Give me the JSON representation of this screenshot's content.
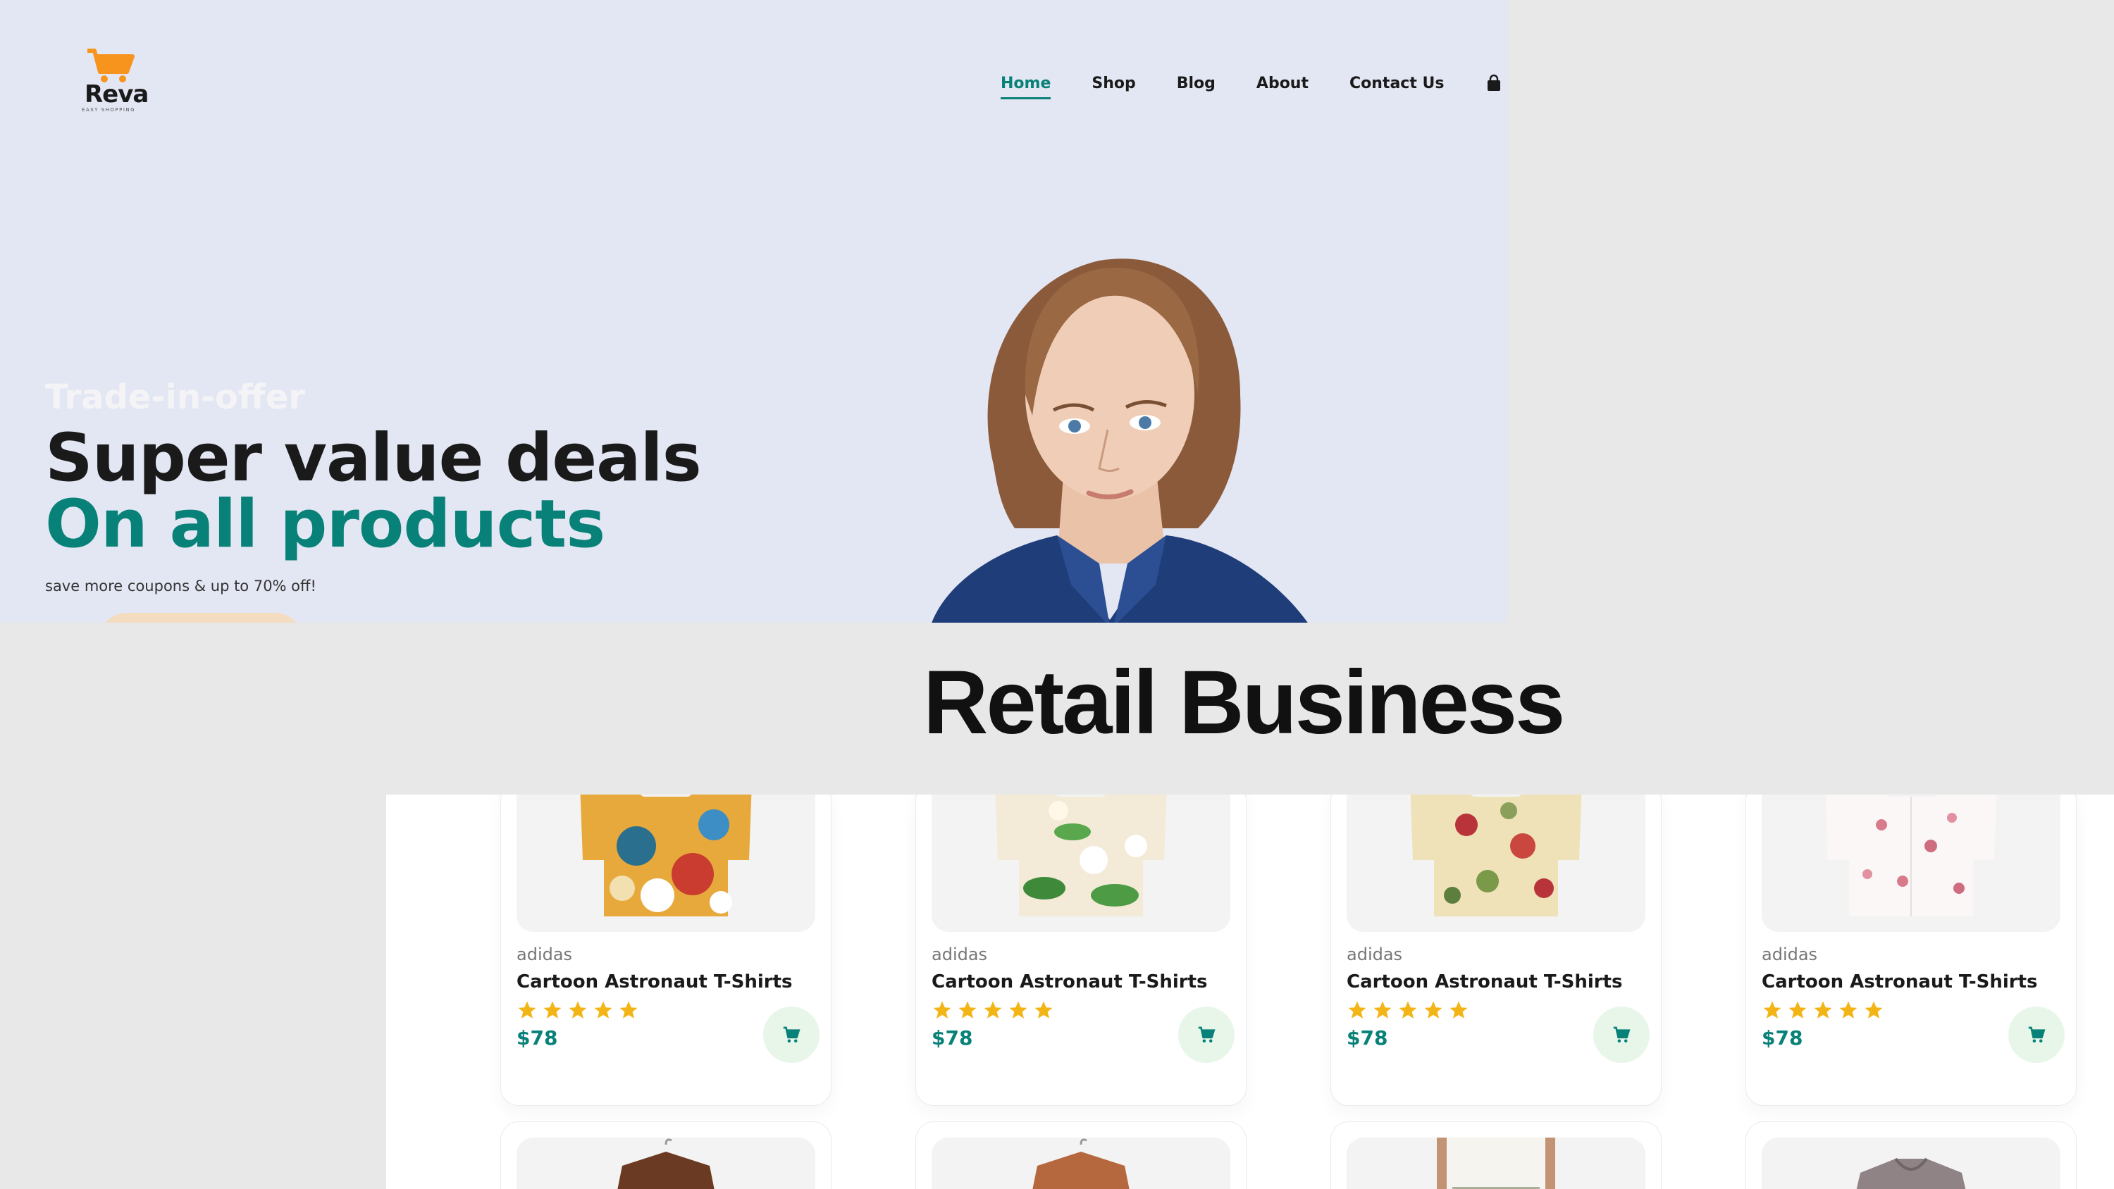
{
  "header": {
    "brand": "Reva",
    "tagline": "EASY SHOPPING",
    "nav": [
      {
        "label": "Home"
      },
      {
        "label": "Shop"
      },
      {
        "label": "Blog"
      },
      {
        "label": "About"
      },
      {
        "label": "Contact Us"
      }
    ],
    "icons": [
      "cart-logo-icon",
      "shopping-bag-icon"
    ]
  },
  "hero": {
    "eyebrow": "Trade-in-offer",
    "headline_1": "Super value deals",
    "headline_2": "On all products",
    "subtext": "save more coupons & up to 70% off!"
  },
  "banner": {
    "title": "Retail Business"
  },
  "products": [
    {
      "brand": "adidas",
      "name": "Cartoon Astronaut T-Shirts",
      "rating": 5,
      "price": "$78"
    },
    {
      "brand": "adidas",
      "name": "Cartoon Astronaut T-Shirts",
      "rating": 5,
      "price": "$78"
    },
    {
      "brand": "adidas",
      "name": "Cartoon Astronaut T-Shirts",
      "rating": 5,
      "price": "$78"
    },
    {
      "brand": "adidas",
      "name": "Cartoon Astronaut T-Shirts",
      "rating": 5,
      "price": "$78"
    }
  ],
  "colors": {
    "accent": "#088178",
    "hero_bg": "#e3e6f3",
    "logo_orange": "#f7941d",
    "star": "#f3b516",
    "cart_btn_bg": "#e8f6ea"
  }
}
